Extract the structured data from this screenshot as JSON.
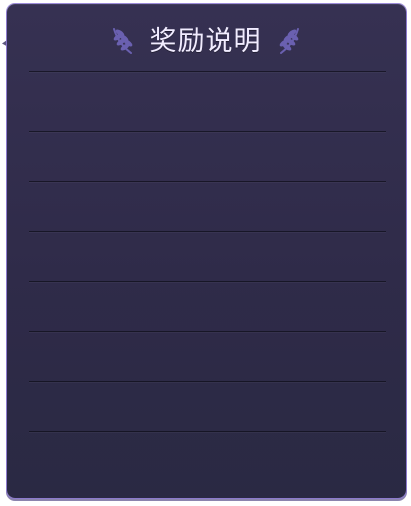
{
  "panel": {
    "title": "奖励说明"
  },
  "theme": {
    "panel_top": "#363152",
    "panel_bottom": "#2a2943",
    "border_glow": "#8c78d2",
    "title_color": "#f1ecff",
    "laurel_color": "#6d63b6"
  },
  "icons": {
    "left": "laurel-left-icon",
    "right": "laurel-right-icon"
  }
}
